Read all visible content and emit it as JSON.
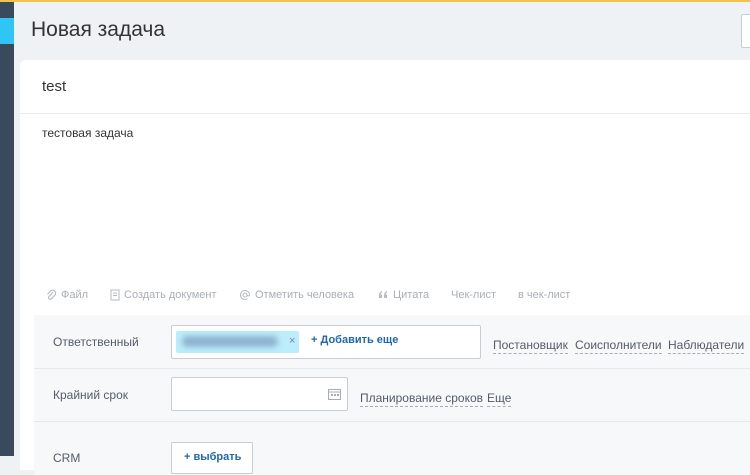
{
  "page": {
    "title": "Новая задача"
  },
  "task": {
    "title": "test",
    "description": "тестовая задача"
  },
  "toolbar": {
    "file": "Файл",
    "create_doc": "Создать документ",
    "mention": "Отметить человека",
    "quote": "Цитата",
    "checklist": "Чек-лист",
    "to_checklist": "в чек-лист"
  },
  "fields": {
    "responsible_label": "Ответственный",
    "responsible_remove": "×",
    "add_more": "+ Добавить еще",
    "creator_link": "Постановщик",
    "coexecutors_link": "Соисполнители",
    "observers_link": "Наблюдатели",
    "deadline_label": "Крайний срок",
    "planning_link": "Планирование сроков",
    "more_link": "Еще",
    "crm_label": "CRM",
    "crm_button": "+ выбрать"
  },
  "colors": {
    "accent_blue": "#2067b0",
    "chip_bg": "#bcedfc",
    "sidebar": "#3a4a5d",
    "highlight": "#2fc6f6"
  }
}
